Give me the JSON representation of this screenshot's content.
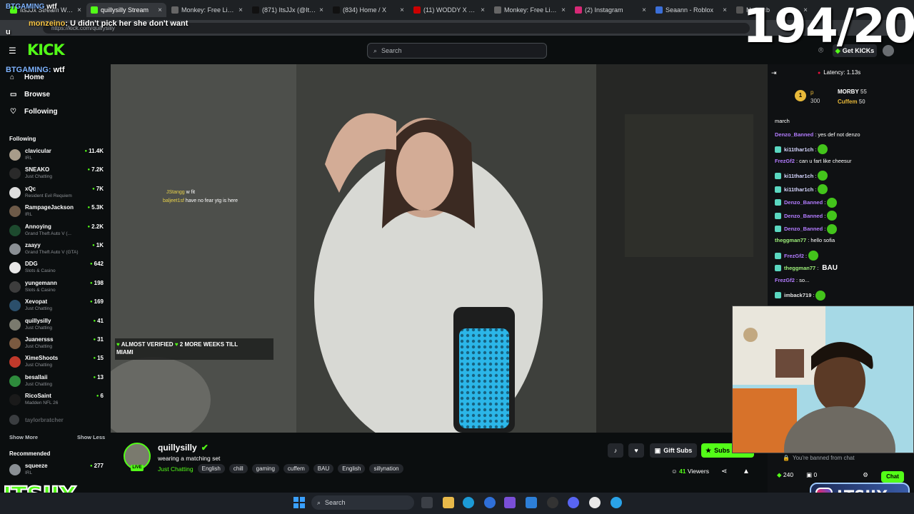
{
  "browser": {
    "tabs": [
      {
        "label": "ItsJJx Stream Watch",
        "color": "#53fc18"
      },
      {
        "label": "quillysilly Stream",
        "color": "#53fc18"
      },
      {
        "label": "Monkey: Free Live V",
        "color": "#666"
      },
      {
        "label": "(871) ItsJJx (@ItsJJx_",
        "color": "#111"
      },
      {
        "label": "(834) Home / X",
        "color": "#111"
      },
      {
        "label": "(11) WODDY X MHA",
        "color": "#c00"
      },
      {
        "label": "Monkey: Free Live V",
        "color": "#666"
      },
      {
        "label": "(2) Instagram",
        "color": "#d62976"
      },
      {
        "label": "Seaann - Roblox",
        "color": "#3b6fd8"
      },
      {
        "label": "New tab",
        "color": "#555"
      }
    ],
    "url": "https://kick.com/quillysilly"
  },
  "overlay": {
    "top_channel": "BTGAMING",
    "top_channel_suffix": "wtf",
    "counter": "194/200",
    "chat_user": "monzeino",
    "chat_text": ": U didn't pick her she don't want",
    "chat_text2": "u",
    "side_user": "BTGAMING:",
    "side_text": "wtf",
    "brand_left": "ITSJJX",
    "brand_right": "LTSJJX"
  },
  "header": {
    "logo": "KICK",
    "search_placeholder": "Search",
    "get_kicks": "Get KICKs"
  },
  "sidebar": {
    "nav": [
      {
        "label": "Home",
        "icon": "home-icon",
        "glyph": "⌂"
      },
      {
        "label": "Browse",
        "icon": "browse-icon",
        "glyph": "▭"
      },
      {
        "label": "Following",
        "icon": "heart-icon",
        "glyph": "♡"
      }
    ],
    "following_heading": "Following",
    "channels": [
      {
        "name": "clavicular",
        "category": "IRL",
        "viewers": "11.4K",
        "color": "#a89c8a"
      },
      {
        "name": "SNEAKO",
        "category": "Just Chatting",
        "viewers": "7.2K",
        "color": "#2a2a2a"
      },
      {
        "name": "xQc",
        "category": "Resident Evil Requiem",
        "viewers": "7K",
        "color": "#ddd"
      },
      {
        "name": "RampageJackson",
        "category": "IRL",
        "viewers": "5.3K",
        "color": "#6d5a48"
      },
      {
        "name": "Annoying",
        "category": "Grand Theft Auto V (...",
        "viewers": "2.2K",
        "color": "#1d4a2e"
      },
      {
        "name": "zaayy",
        "category": "Grand Theft Auto V (GTA)",
        "viewers": "1K",
        "color": "#8a8f94"
      },
      {
        "name": "DDG",
        "category": "Slots & Casino",
        "viewers": "642",
        "color": "#e8e8e8"
      },
      {
        "name": "yungemann",
        "category": "Slots & Casino",
        "viewers": "198",
        "color": "#3d3d3d"
      },
      {
        "name": "Xevopat",
        "category": "Just Chatting",
        "viewers": "169",
        "color": "#2b4f6b"
      },
      {
        "name": "quillysilly",
        "category": "Just Chatting",
        "viewers": "41",
        "color": "#7a7a6e"
      },
      {
        "name": "Juanersss",
        "category": "Just Chatting",
        "viewers": "31",
        "color": "#7b5a40"
      },
      {
        "name": "XimeShoots",
        "category": "Just Chatting",
        "viewers": "15",
        "color": "#c0392b"
      },
      {
        "name": "besallaii",
        "category": "Just Chatting",
        "viewers": "13",
        "color": "#2e8b3c"
      },
      {
        "name": "RicoSaint",
        "category": "Madden NFL 26",
        "viewers": "6",
        "color": "#1a1a1a"
      }
    ],
    "offline_channel": "taylorbratcher",
    "show_more": "Show More",
    "show_less": "Show Less",
    "recommended_heading": "Recommended",
    "recommended": [
      {
        "name": "squeeze",
        "category": "IRL",
        "viewers": "277",
        "color": "#8a8f94"
      }
    ]
  },
  "video": {
    "overlay_chat": [
      {
        "user": "JStangg",
        "text": "w fit"
      },
      {
        "user": "baljeet1sf",
        "text": "have no fear ytg is here"
      }
    ],
    "goal_line1": "ALMOST VERIFIED",
    "goal_line1b": "2 MORE WEEKS TILL",
    "goal_line2": "MIAMI"
  },
  "stream": {
    "channel": "quillysilly",
    "title": "wearing a matching set",
    "live_label": "LIVE",
    "category": "Just Chatting",
    "tags": [
      "English",
      "chill",
      "gaming",
      "cuffem",
      "BAU",
      "English",
      "sillynation"
    ],
    "gift_subs": "Gift Subs",
    "subscribe": "Subs",
    "viewers": "41",
    "viewers_label": "Viewers"
  },
  "chat": {
    "latency": "Latency: 1.13s",
    "pinned": {
      "rank1_label": "p",
      "rank1_value": "300",
      "rank2": "MORBY",
      "rank2_value": "55",
      "rank3": "Cuffem",
      "rank3_value": "50"
    },
    "messages": [
      {
        "user": "",
        "text": "march",
        "ucolor": "#fff",
        "emote": false
      },
      {
        "user": "Denzo_Banned",
        "text": ": yes def not denzo",
        "ucolor": "#b37cff",
        "emote": false
      },
      {
        "user": "ki11thar1ch",
        "text": ":",
        "ucolor": "#d6d6ff",
        "emote": true
      },
      {
        "user": "FrezGf2",
        "text": ": can u fart like cheesur",
        "ucolor": "#b37cff",
        "emote": false
      },
      {
        "user": "ki11thar1ch",
        "text": ":",
        "ucolor": "#d6d6ff",
        "emote": true
      },
      {
        "user": "ki11thar1ch",
        "text": ":",
        "ucolor": "#d6d6ff",
        "emote": true
      },
      {
        "user": "Denzo_Banned",
        "text": ":",
        "ucolor": "#b37cff",
        "emote": true
      },
      {
        "user": "Denzo_Banned",
        "text": ":",
        "ucolor": "#b37cff",
        "emote": true
      },
      {
        "user": "Denzo_Banned",
        "text": ":",
        "ucolor": "#b37cff",
        "emote": true
      },
      {
        "user": "theggman77",
        "text": ": hello sofia",
        "ucolor": "#9ef07a",
        "emote": false
      },
      {
        "user": "FrezGf2",
        "text": ":",
        "ucolor": "#b37cff",
        "emote": true
      },
      {
        "user": "theggman77",
        "text": ":",
        "ucolor": "#9ef07a",
        "emote": false,
        "word": "BAU"
      },
      {
        "user": "FrezGf2",
        "text": ": so...",
        "ucolor": "#b37cff",
        "emote": false
      },
      {
        "user": "imback719",
        "text": ":",
        "ucolor": "#e2e2e2",
        "emote": true
      }
    ],
    "banned_notice": "You're banned from chat",
    "kicks_count": "240",
    "other_count": "0",
    "chat_button": "Chat"
  },
  "taskbar": {
    "search": "Search"
  }
}
